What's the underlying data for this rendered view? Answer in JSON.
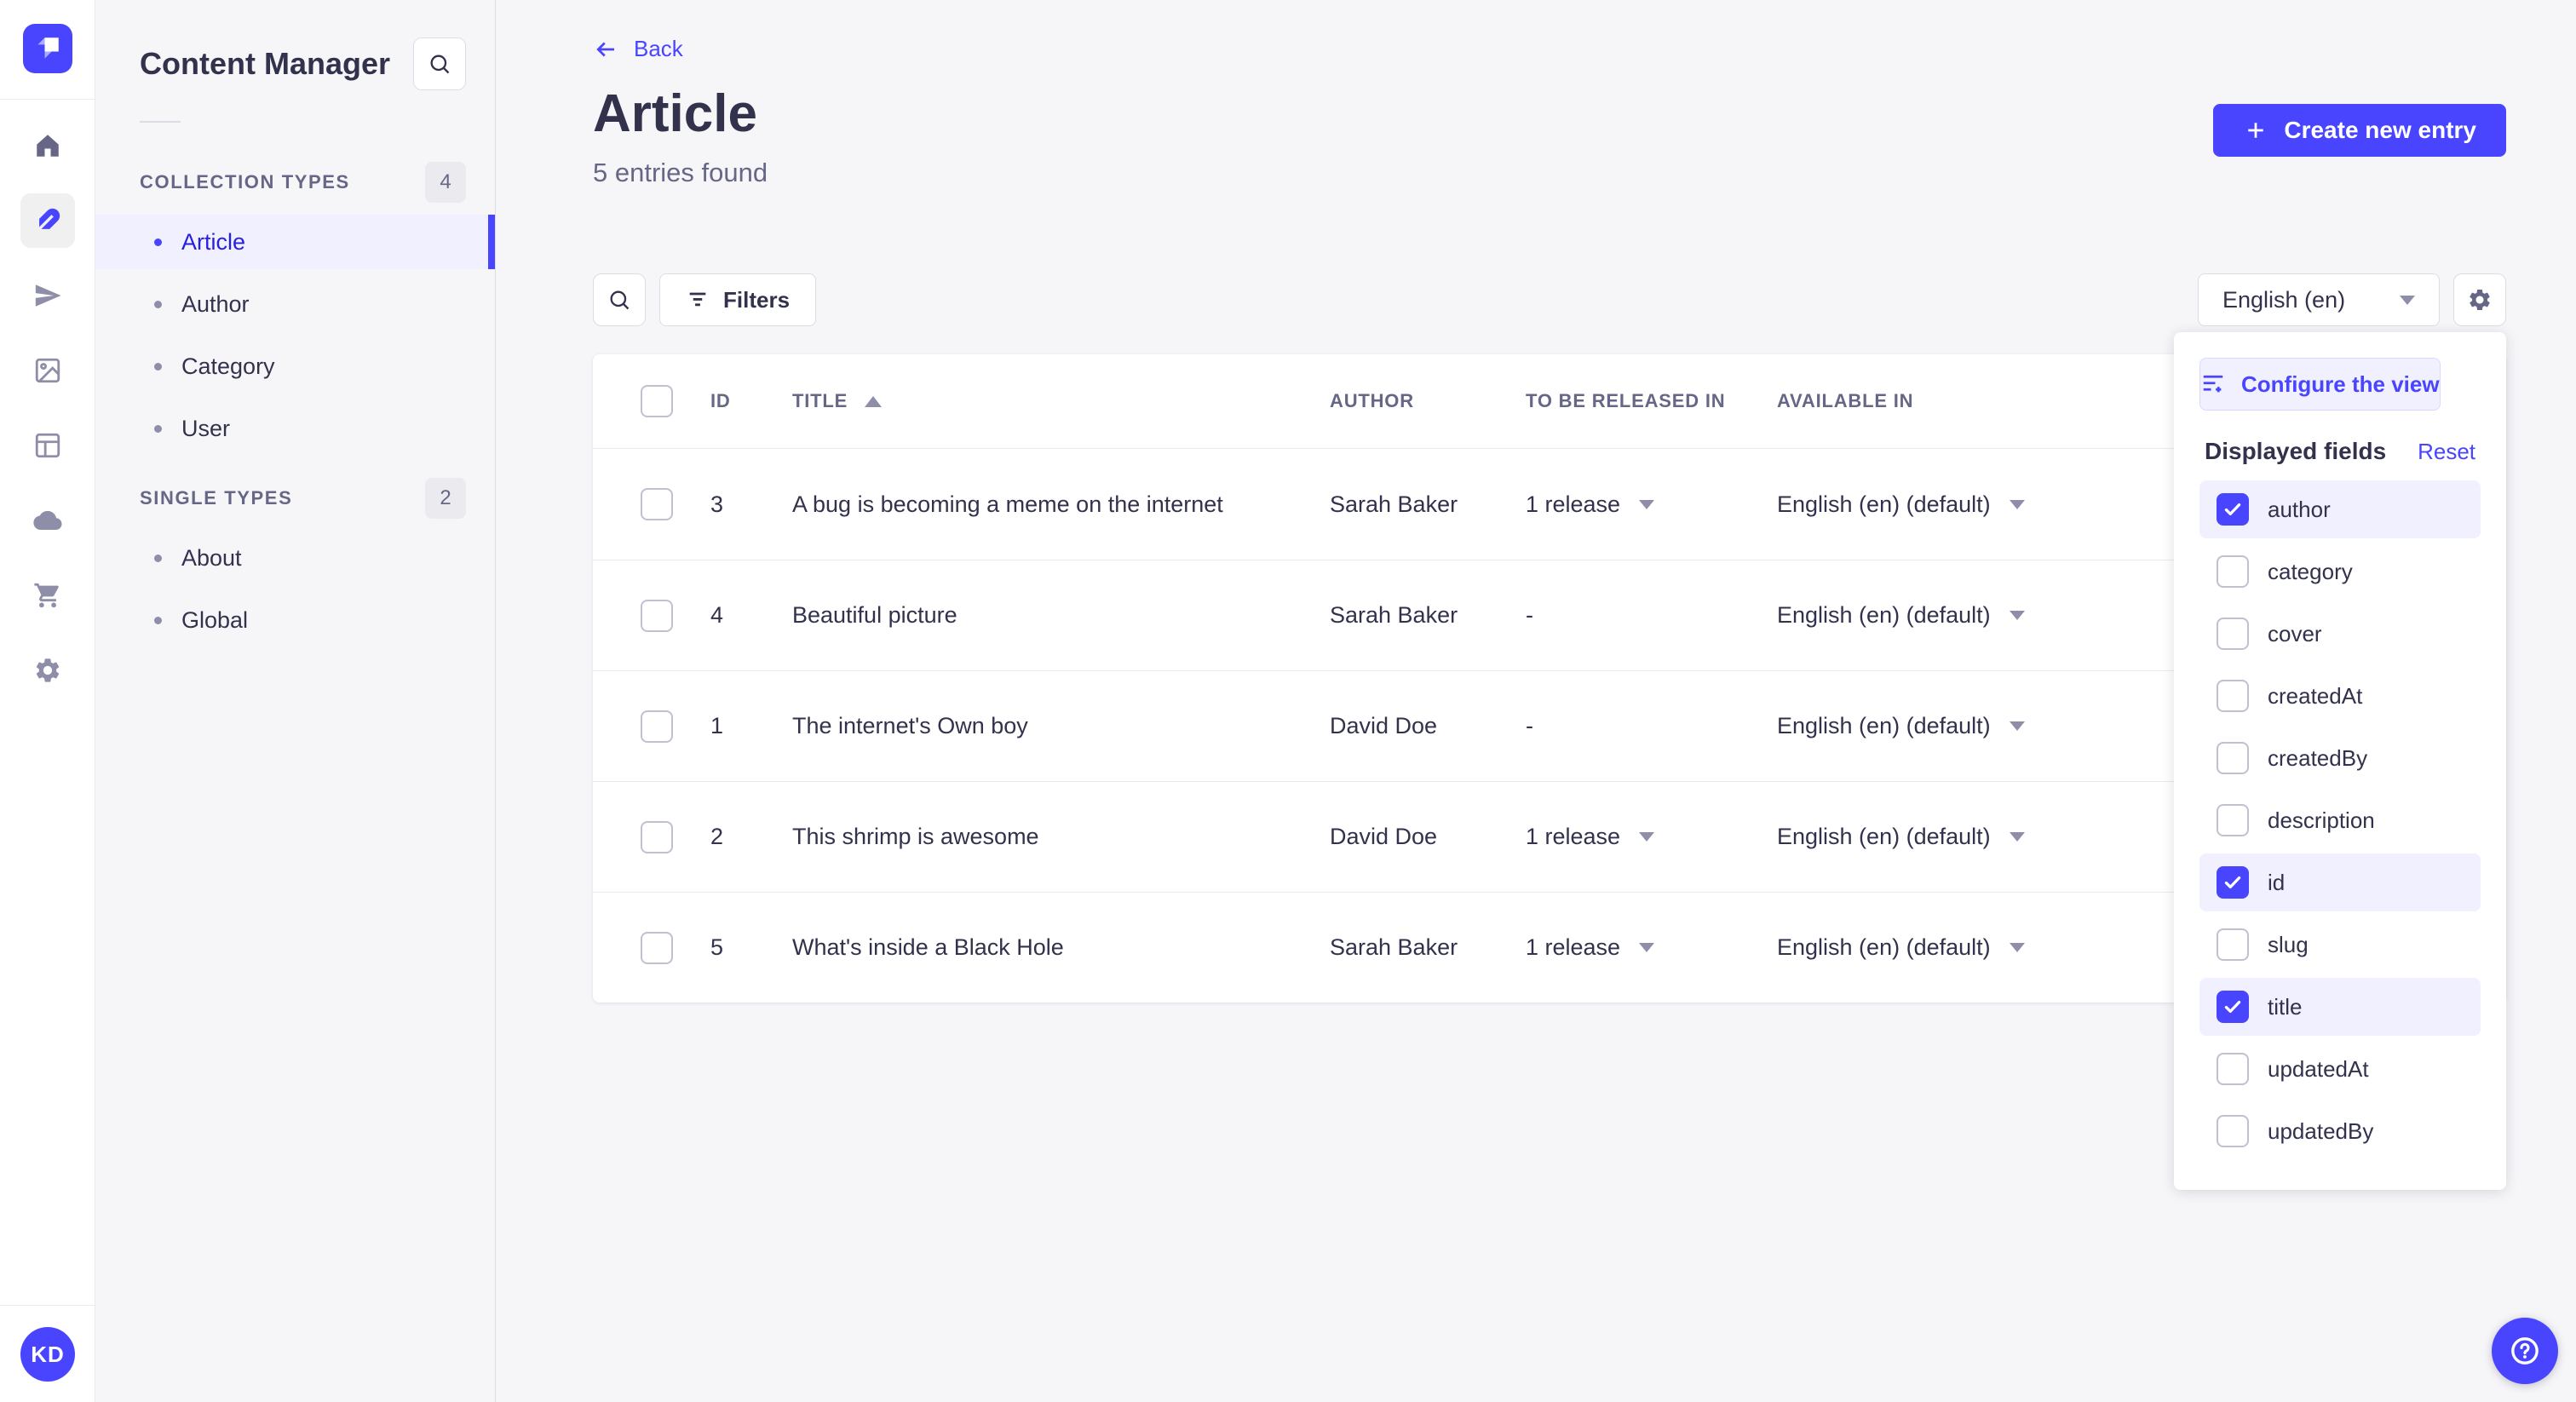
{
  "colors": {
    "primary": "#4945ff",
    "primary_dark": "#271fe0",
    "primary_light": "#f0f0ff",
    "neutral_border": "#dcdce4"
  },
  "rail": {
    "icons": [
      "strapi-logo",
      "home-icon",
      "feather-icon",
      "send-icon",
      "media-icon",
      "layout-icon",
      "cloud-icon",
      "cart-icon",
      "gear-icon"
    ],
    "avatar_initials": "KD"
  },
  "subnav": {
    "title": "Content Manager",
    "sections": [
      {
        "label": "COLLECTION TYPES",
        "badge": "4",
        "items": [
          {
            "label": "Article",
            "active": true
          },
          {
            "label": "Author",
            "active": false
          },
          {
            "label": "Category",
            "active": false
          },
          {
            "label": "User",
            "active": false
          }
        ]
      },
      {
        "label": "SINGLE TYPES",
        "badge": "2",
        "items": [
          {
            "label": "About",
            "active": false
          },
          {
            "label": "Global",
            "active": false
          }
        ]
      }
    ]
  },
  "header": {
    "back_label": "Back",
    "title": "Article",
    "subtitle": "5 entries found",
    "create_label": "Create new entry"
  },
  "toolbar": {
    "filters_label": "Filters",
    "locale_value": "English (en)"
  },
  "table": {
    "columns": [
      "ID",
      "TITLE",
      "AUTHOR",
      "TO BE RELEASED IN",
      "AVAILABLE IN"
    ],
    "sorted_column": "TITLE",
    "sort_direction": "asc",
    "rows": [
      {
        "id": "3",
        "title": "A bug is becoming a meme on the internet",
        "author": "Sarah Baker",
        "release": "1 release",
        "locale": "English (en) (default)"
      },
      {
        "id": "4",
        "title": "Beautiful picture",
        "author": "Sarah Baker",
        "release": "-",
        "locale": "English (en) (default)"
      },
      {
        "id": "1",
        "title": "The internet's Own boy",
        "author": "David Doe",
        "release": "-",
        "locale": "English (en) (default)"
      },
      {
        "id": "2",
        "title": "This shrimp is awesome",
        "author": "David Doe",
        "release": "1 release",
        "locale": "English (en) (default)"
      },
      {
        "id": "5",
        "title": "What's inside a Black Hole",
        "author": "Sarah Baker",
        "release": "1 release",
        "locale": "English (en) (default)"
      }
    ]
  },
  "popover": {
    "configure_label": "Configure the view",
    "fields_title": "Displayed fields",
    "reset_label": "Reset",
    "fields": [
      {
        "label": "author",
        "checked": true
      },
      {
        "label": "category",
        "checked": false
      },
      {
        "label": "cover",
        "checked": false
      },
      {
        "label": "createdAt",
        "checked": false
      },
      {
        "label": "createdBy",
        "checked": false
      },
      {
        "label": "description",
        "checked": false
      },
      {
        "label": "id",
        "checked": true
      },
      {
        "label": "slug",
        "checked": false
      },
      {
        "label": "title",
        "checked": true
      },
      {
        "label": "updatedAt",
        "checked": false
      },
      {
        "label": "updatedBy",
        "checked": false
      }
    ]
  }
}
